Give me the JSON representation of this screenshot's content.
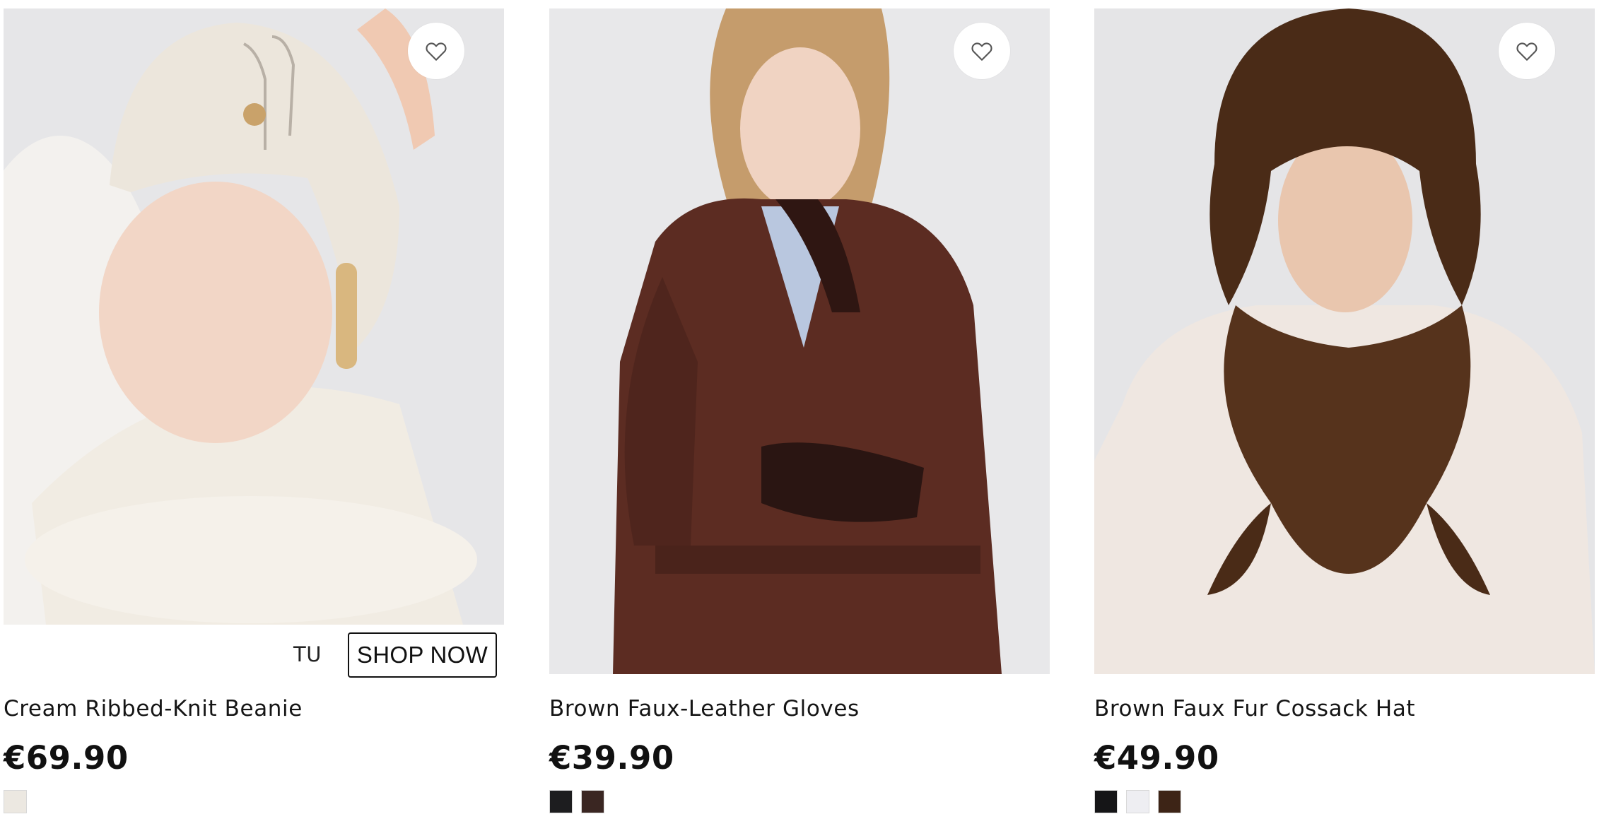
{
  "products": [
    {
      "name": "Cream Ribbed-Knit Beanie",
      "price": "€69.90",
      "size_label": "TU",
      "cta": "SHOP NOW",
      "wishlist_icon": "heart-outline-icon",
      "swatches": [
        "#ece8e1"
      ]
    },
    {
      "name": "Brown Faux-Leather Gloves",
      "price": "€39.90",
      "wishlist_icon": "heart-outline-icon",
      "swatches": [
        "#1d1d1f",
        "#3a2622"
      ]
    },
    {
      "name": "Brown Faux Fur Cossack Hat",
      "price": "€49.90",
      "wishlist_icon": "heart-outline-icon",
      "swatches": [
        "#151517",
        "#eeeef2",
        "#3d2416"
      ]
    }
  ]
}
